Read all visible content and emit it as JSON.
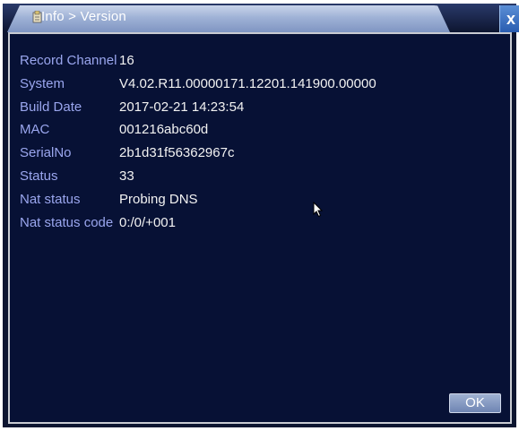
{
  "window": {
    "title": "Info > Version",
    "close_label": "x"
  },
  "info_rows": [
    {
      "label": "Record Channel",
      "value": "16"
    },
    {
      "label": "System",
      "value": "V4.02.R11.00000171.12201.141900.00000"
    },
    {
      "label": "Build Date",
      "value": "2017-02-21 14:23:54"
    },
    {
      "label": "MAC",
      "value": "001216abc60d"
    },
    {
      "label": "SerialNo",
      "value": "2b1d31f56362967c"
    },
    {
      "label": "Status",
      "value": "33"
    },
    {
      "label": "Nat status",
      "value": "Probing DNS"
    },
    {
      "label": "Nat status code",
      "value": "0:/0/+001"
    }
  ],
  "buttons": {
    "ok_label": "OK"
  },
  "icons": {
    "title_icon": "info-icon",
    "close_icon": "close-icon",
    "cursor": "mouse-pointer-icon"
  },
  "colors": {
    "panel_bg": "#071135",
    "label_color": "#9aa6ee",
    "value_color": "#f2f2f2",
    "tab_highlight": "#9fb2d6"
  }
}
